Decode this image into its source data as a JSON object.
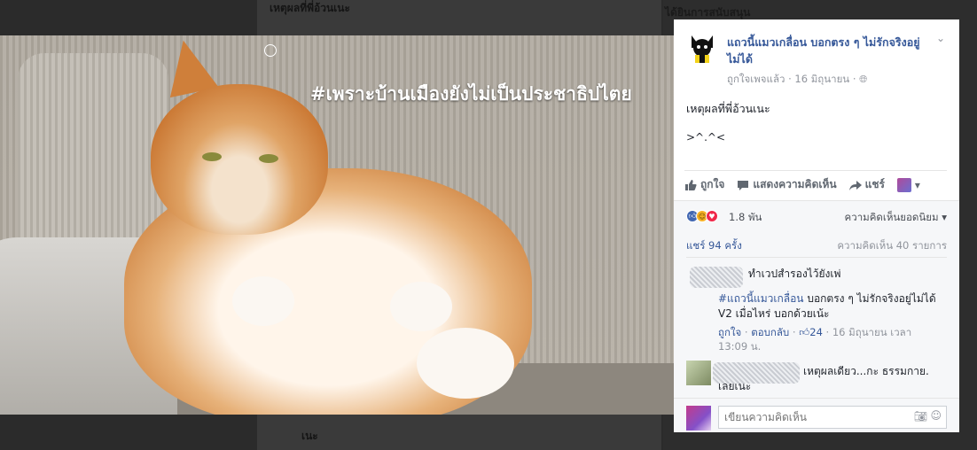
{
  "background": {
    "top_caption": "เหตุผลที่พี่อ้วนเนะ",
    "right_caption": "ได้ยินการสนับสนุน",
    "bottom_caption": "เนะ"
  },
  "photo": {
    "caption": "#เพราะบ้านเมืองยังไม่เป็นประชาธิปไตย"
  },
  "post": {
    "page_name": "แถวนี้แมวเกลื่อน บอกตรง ๆ ไม่รักจริงอยู่ไม่ได้",
    "liked_status": "ถูกใจเพจแล้ว",
    "date": "16 มิถุนายน",
    "text": "เหตุผลที่พี่อ้วนเนะ",
    "emoticon": ">^.^<"
  },
  "actions": {
    "like": "ถูกใจ",
    "comment": "แสดงความคิดเห็น",
    "share": "แชร์"
  },
  "stats": {
    "reaction_count": "1.8 พัน",
    "top_comments": "ความคิดเห็นยอดนิยม",
    "shares": "แชร์ 94 ครั้ง",
    "comment_count": "ความคิดเห็น 40 รายการ"
  },
  "comments": [
    {
      "text": "ทำเวปสำรองไว้ยังเพ่",
      "link": "#แถวนี้แมวเกลื่อน",
      "reply": "บอกตรง ๆ ไม่รักจริงอยู่ไม่ได้ V2 เมื่อไหร่ บอกด้วยเน้ะ",
      "like_action": "ถูกใจ",
      "reply_action": "ตอบกลับ",
      "likes": "24",
      "time": "16 มิถุนายน เวลา 13:09 น."
    },
    {
      "text": "เหตุผลเดียว...กะ ธรรมกาย.",
      "text2": "เลยเนะ"
    }
  ],
  "composer": {
    "placeholder": "เขียนความคิดเห็น"
  },
  "colors": {
    "link_blue": "#365899",
    "like_blue": "#4267b2",
    "love_red": "#f0284a",
    "haha_yellow": "#f7b125"
  }
}
